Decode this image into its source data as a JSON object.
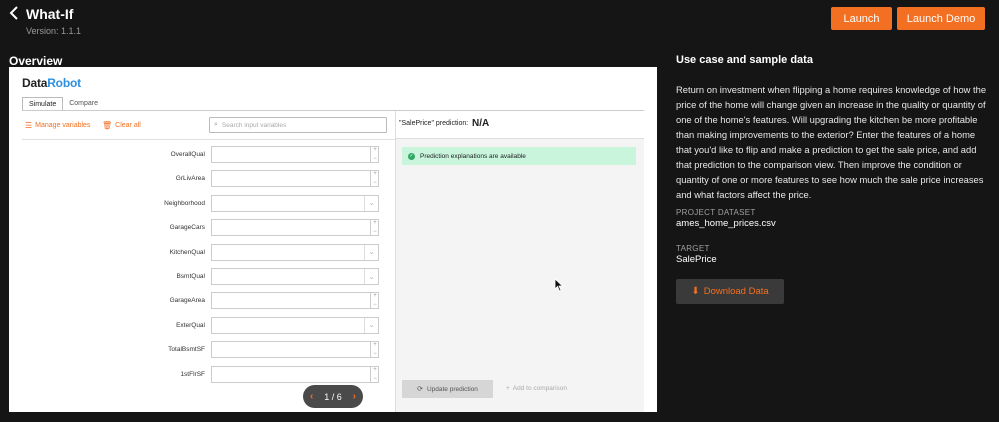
{
  "header": {
    "title": "What-If",
    "version": "Version: 1.1.1",
    "launch_label": "Launch",
    "launch_demo_label": "Launch Demo"
  },
  "overview": {
    "title": "Overview",
    "logo_part1": "Data",
    "logo_part2": "Robot",
    "tabs": [
      "Simulate",
      "Compare"
    ],
    "manage_variables": "Manage variables",
    "clear_all": "Clear all",
    "search_placeholder": "Search input variables",
    "variables": [
      {
        "label": "OverallQual",
        "kind": "number"
      },
      {
        "label": "GrLivArea",
        "kind": "number"
      },
      {
        "label": "Neighborhood",
        "kind": "select"
      },
      {
        "label": "GarageCars",
        "kind": "number"
      },
      {
        "label": "KitchenQual",
        "kind": "select"
      },
      {
        "label": "BsmtQual",
        "kind": "select"
      },
      {
        "label": "GarageArea",
        "kind": "number"
      },
      {
        "label": "ExterQual",
        "kind": "select"
      },
      {
        "label": "TotalBsmtSF",
        "kind": "number"
      },
      {
        "label": "1stFlrSF",
        "kind": "number"
      }
    ],
    "prediction_label": "\"SalePrice\" prediction:",
    "prediction_value": "N/A",
    "explanations_text": "Prediction explanations are available",
    "update_prediction": "Update prediction",
    "add_to_comparison": "Add to comparison",
    "pager_text": "1 / 6"
  },
  "info": {
    "title": "Use case and sample data",
    "description": "Return on investment when flipping a home requires knowledge of how the price of the home will change given an increase in the quality or quantity of one of the home's features. Will upgrading the kitchen be more profitable than making improvements to the exterior? Enter the features of a home that you'd like to flip and make a prediction to get the sale price, and add that prediction to the comparison view. Then improve the condition or quantity of one or more features to see how much the sale price increases and what factors affect the price.",
    "dataset_label": "PROJECT DATASET",
    "dataset_value": "ames_home_prices.csv",
    "target_label": "TARGET",
    "target_value": "SalePrice",
    "download_label": "Download Data"
  },
  "colors": {
    "accent": "#f36f21",
    "background": "#151515",
    "success_bg": "#c9f5dd"
  }
}
